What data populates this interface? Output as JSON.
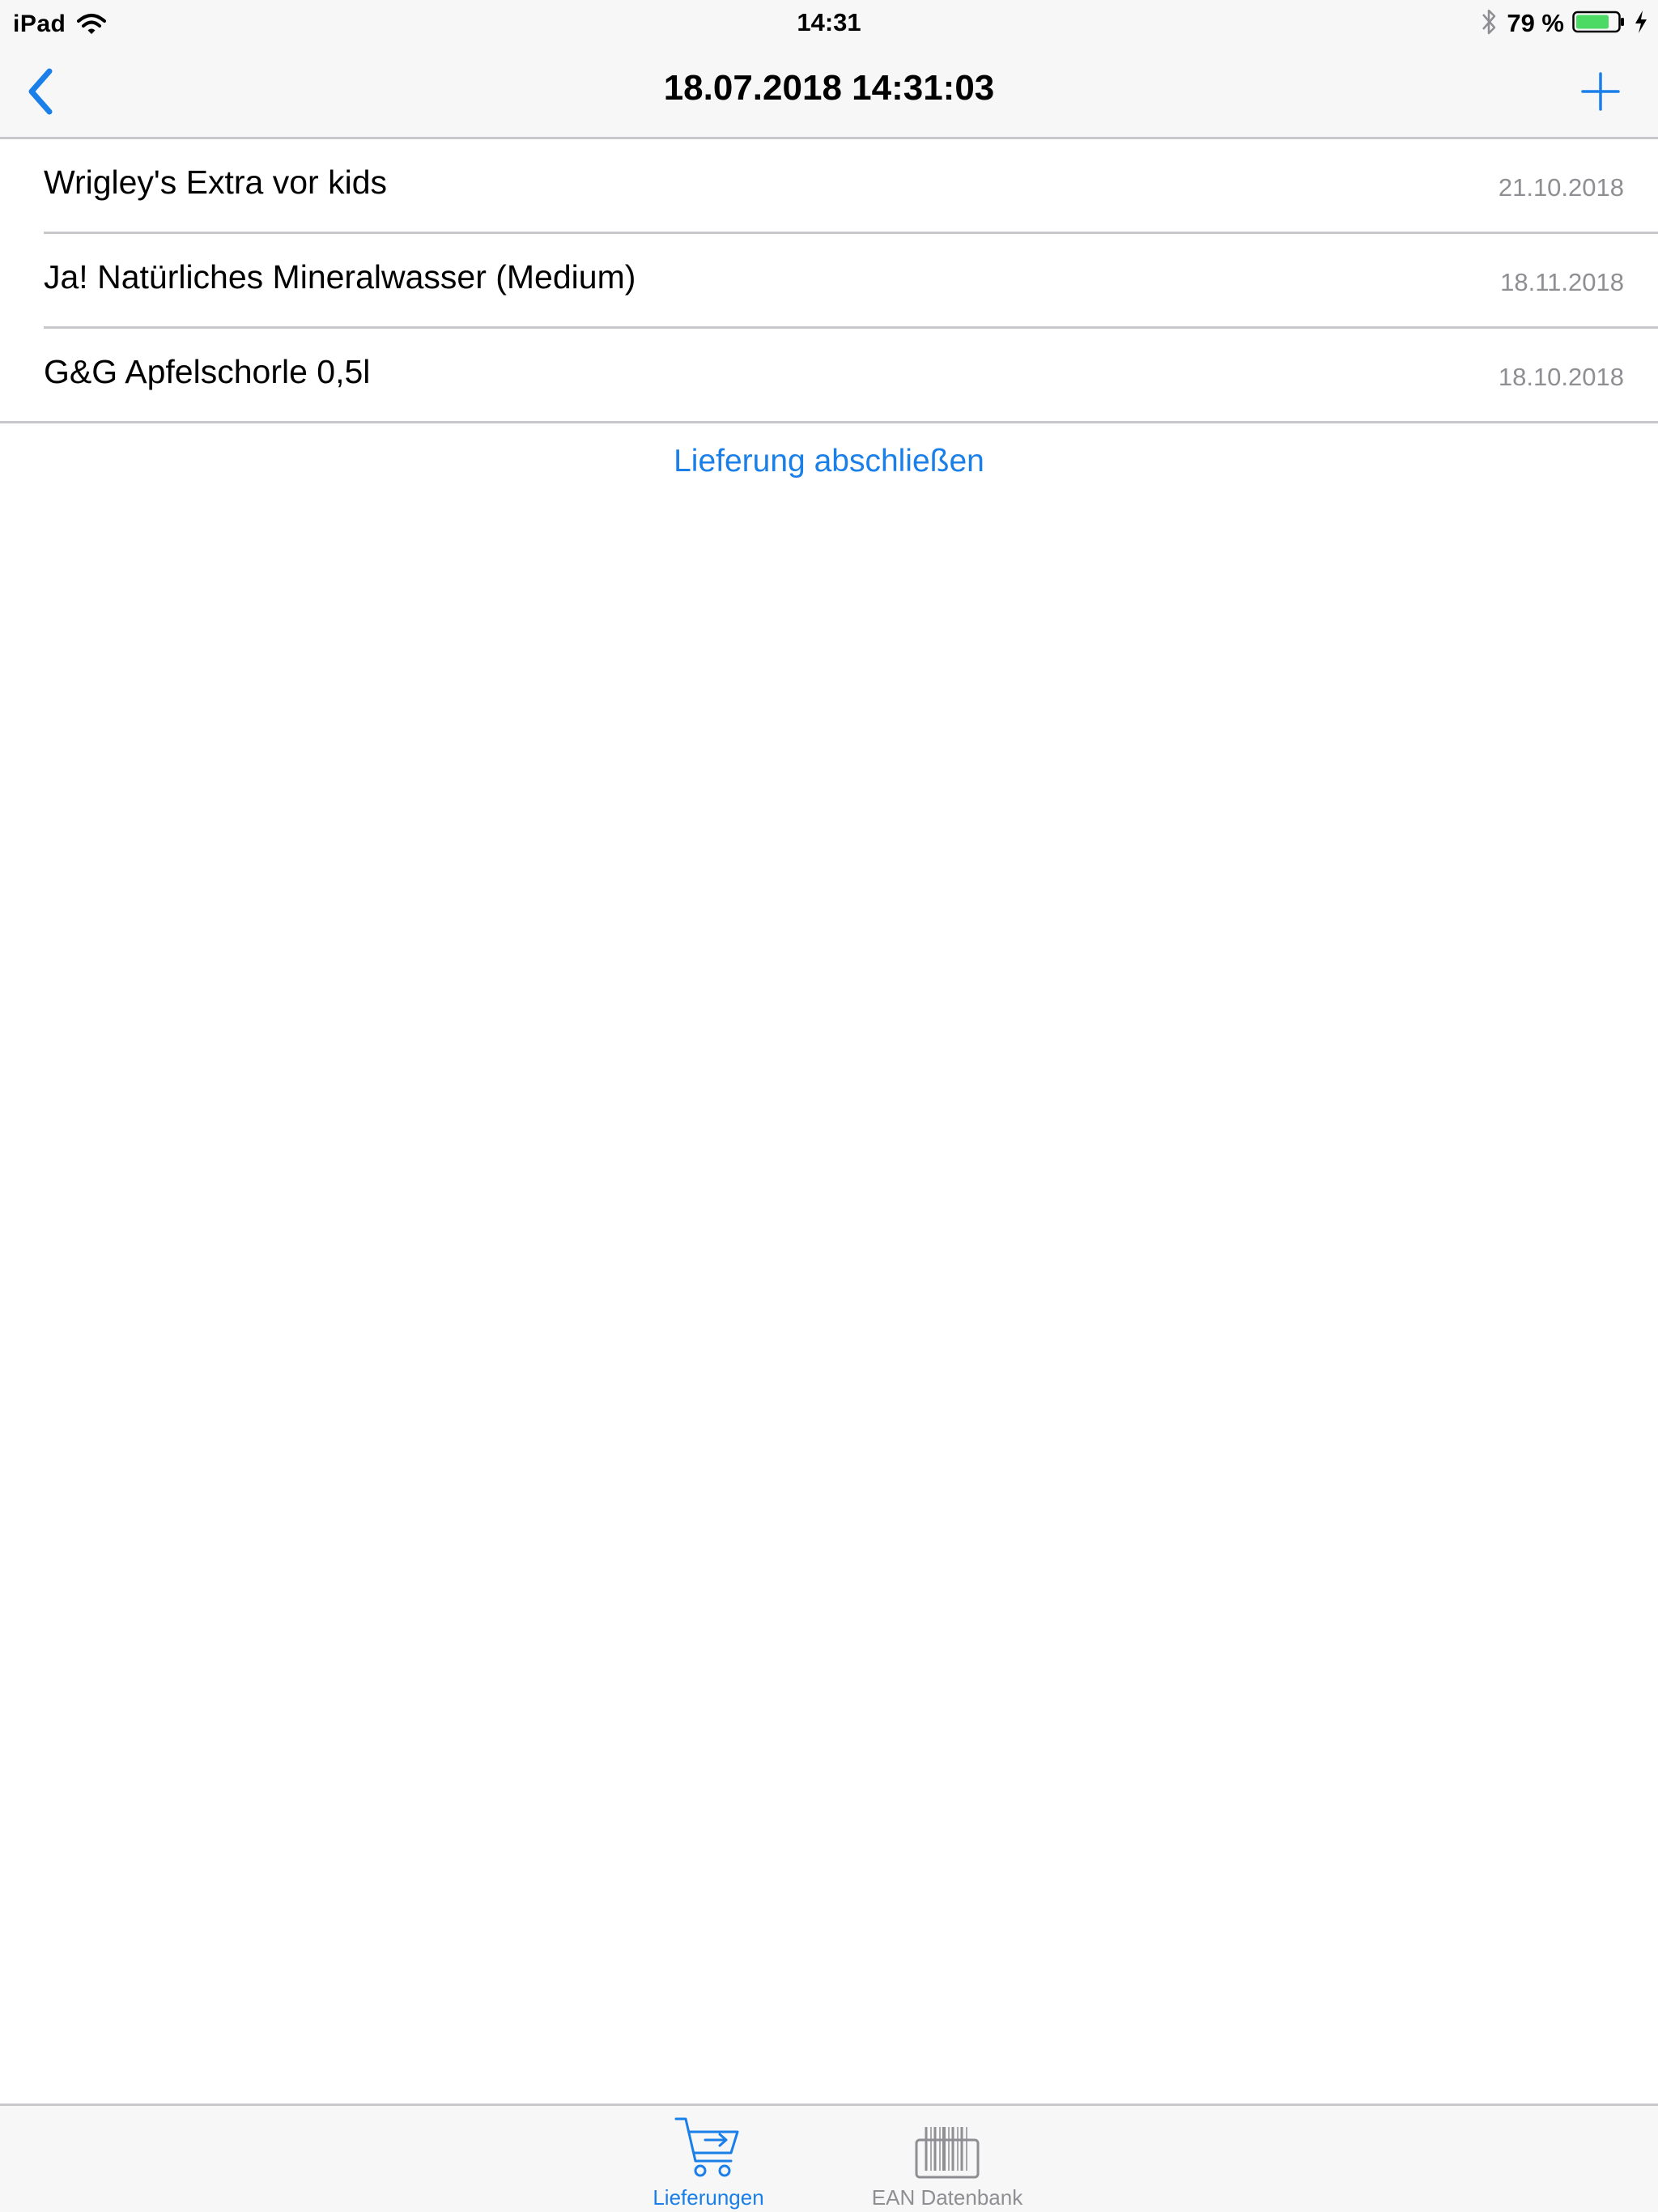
{
  "status_bar": {
    "device": "iPad",
    "time": "14:31",
    "battery_percent": "79 %"
  },
  "nav": {
    "title": "18.07.2018 14:31:03"
  },
  "items": [
    {
      "name": "Wrigley's Extra vor kids",
      "date": "21.10.2018"
    },
    {
      "name": "Ja! Natürliches Mineralwasser (Medium)",
      "date": "18.11.2018"
    },
    {
      "name": "G&G Apfelschorle 0,5l",
      "date": "18.10.2018"
    }
  ],
  "action": {
    "label": "Lieferung abschließen"
  },
  "tabs": [
    {
      "label": "Lieferungen",
      "icon": "cart-icon",
      "selected": true
    },
    {
      "label": "EAN Datenbank",
      "icon": "barcode-icon",
      "selected": false
    }
  ],
  "colors": {
    "accent": "#1a7fe8",
    "secondary_text": "#8e8e93",
    "separator": "#c8c7cc",
    "bar_background": "#f7f7f7",
    "battery_fill": "#4cd964"
  }
}
